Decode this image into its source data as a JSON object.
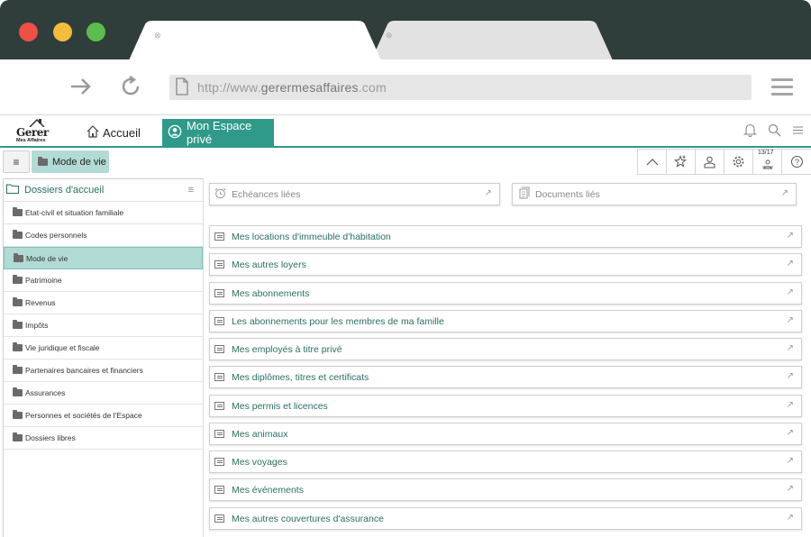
{
  "browser": {
    "url_prefix": "http://www.",
    "url_domain": "gerermesaffaires",
    "url_suffix": ".com"
  },
  "header": {
    "logo_text": "Gerer",
    "logo_subtext": "Mes Affaires",
    "home_label": "Accueil",
    "espace_label": "Mon Espace privé"
  },
  "toolbar": {
    "current_folder": "Mode de vie",
    "counter": "13/17",
    "buttons": [
      "chevron-up-icon",
      "star-add-icon",
      "user-stamp-icon",
      "gear-icon",
      "people-icon",
      "help-icon"
    ]
  },
  "sidebar": {
    "title": "Dossiers d'accueil",
    "items": [
      {
        "label": "Etat-civil et situation familiale",
        "active": false
      },
      {
        "label": "Codes personnels",
        "active": false
      },
      {
        "label": "Mode de vie",
        "active": true
      },
      {
        "label": "Patrimoine",
        "active": false
      },
      {
        "label": "Revenus",
        "active": false
      },
      {
        "label": "Impôts",
        "active": false
      },
      {
        "label": "Vie juridique et fiscale",
        "active": false
      },
      {
        "label": "Partenaires bancaires et financiers",
        "active": false
      },
      {
        "label": "Assurances",
        "active": false
      },
      {
        "label": "Personnes et sociétés de l'Espace",
        "active": false
      },
      {
        "label": "Dossiers libres",
        "active": false
      }
    ]
  },
  "main": {
    "echeances_label": "Echéances liées",
    "documents_label": "Documents liés",
    "rows": [
      "Mes locations d'immeuble d'habitation",
      "Mes autres loyers",
      "Mes abonnements",
      "Les abonnements pour les membres de ma famille",
      "Mes employés à titre privé",
      "Mes diplômes, titres et certificats",
      "Mes permis et licences",
      "Mes animaux",
      "Mes voyages",
      "Mes événements",
      "Mes autres couvertures d'assurance"
    ]
  },
  "colors": {
    "accent": "#2f9a89",
    "accent_light": "#b2dbd5",
    "chrome_dark": "#2f3e3b"
  }
}
